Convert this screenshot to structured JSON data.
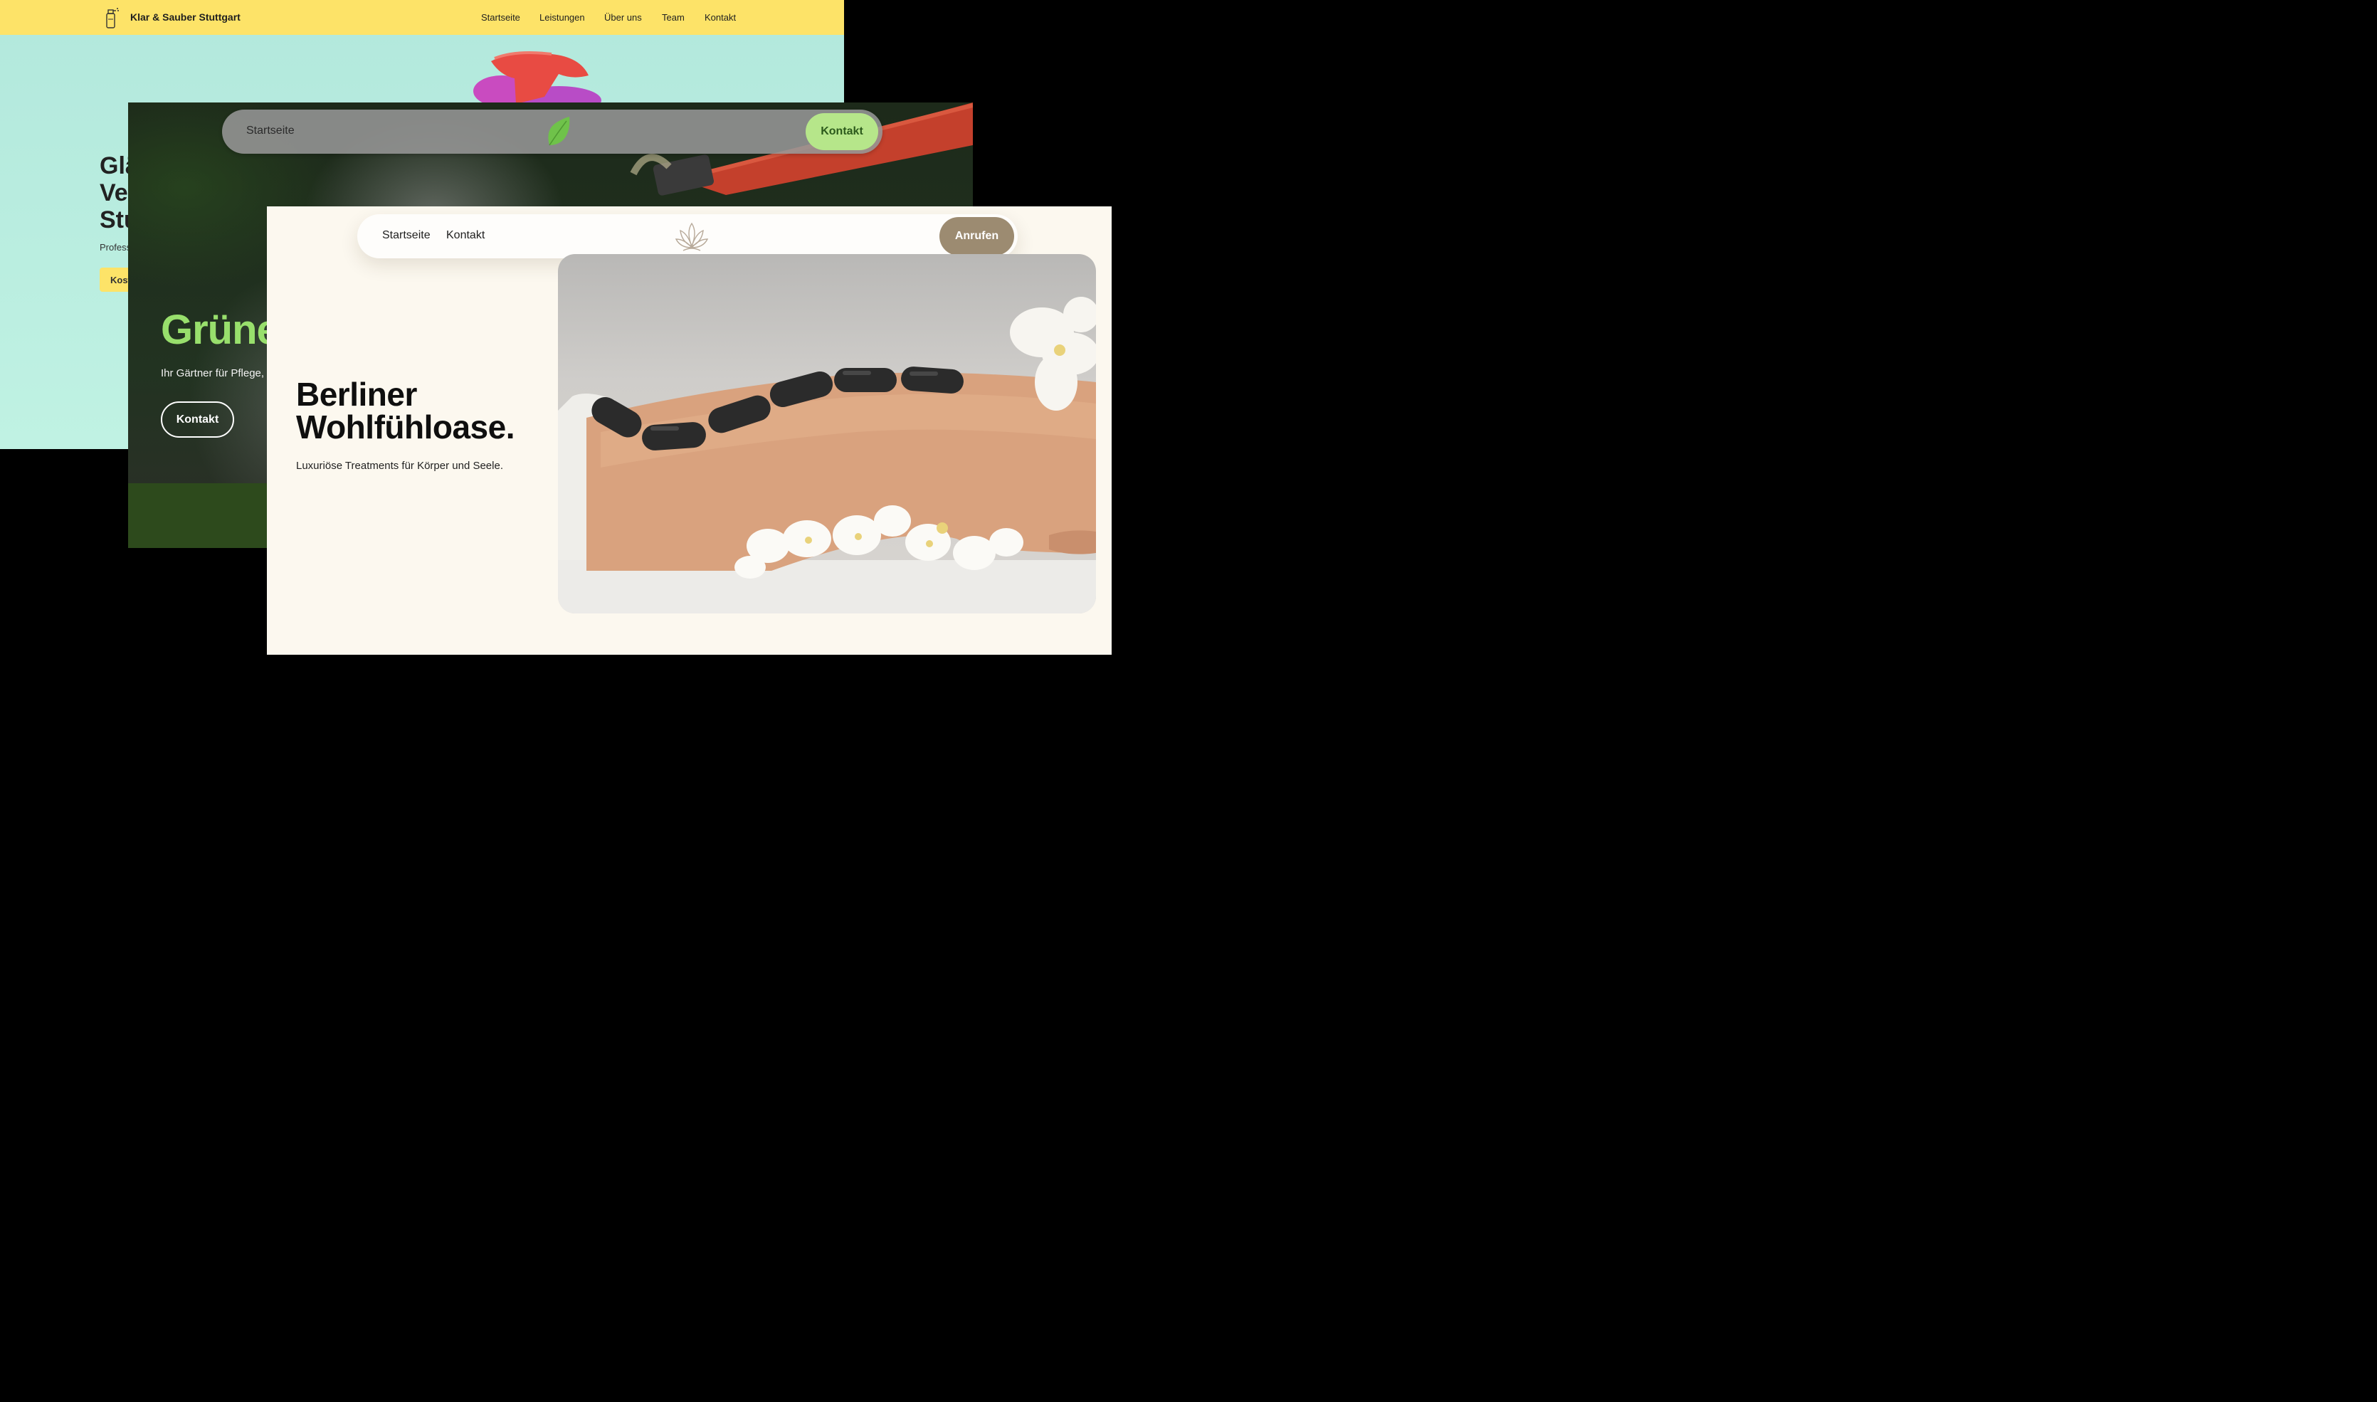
{
  "card_cleaning": {
    "brand": "Klar & Sauber Stuttgart",
    "nav_items": [
      "Startseite",
      "Leistungen",
      "Über uns",
      "Team",
      "Kontakt"
    ],
    "heading_visible": "Glä\nVe\nStu",
    "subtitle_visible": "Professi",
    "cta_visible": "Koste",
    "colors": {
      "nav": "#fde368",
      "hero": "#b2e8dc"
    }
  },
  "card_garden": {
    "nav_home": "Startseite",
    "nav_contact": "Kontakt",
    "heading_visible": "Grüne",
    "subtitle_visible": "Ihr Gärtner für Pflege, ",
    "cta": "Kontakt",
    "colors": {
      "accent": "#98df6c",
      "button": "#b6e68a",
      "footer": "#2d4a1c"
    }
  },
  "card_spa": {
    "nav_home": "Startseite",
    "nav_contact": "Kontakt",
    "call_button": "Anrufen",
    "heading": "Berliner\nWohlfühloase.",
    "subtitle": "Luxuriöse Treatments für Körper und Seele.",
    "colors": {
      "background": "#fcf8ef",
      "button": "#9c8b71"
    }
  }
}
